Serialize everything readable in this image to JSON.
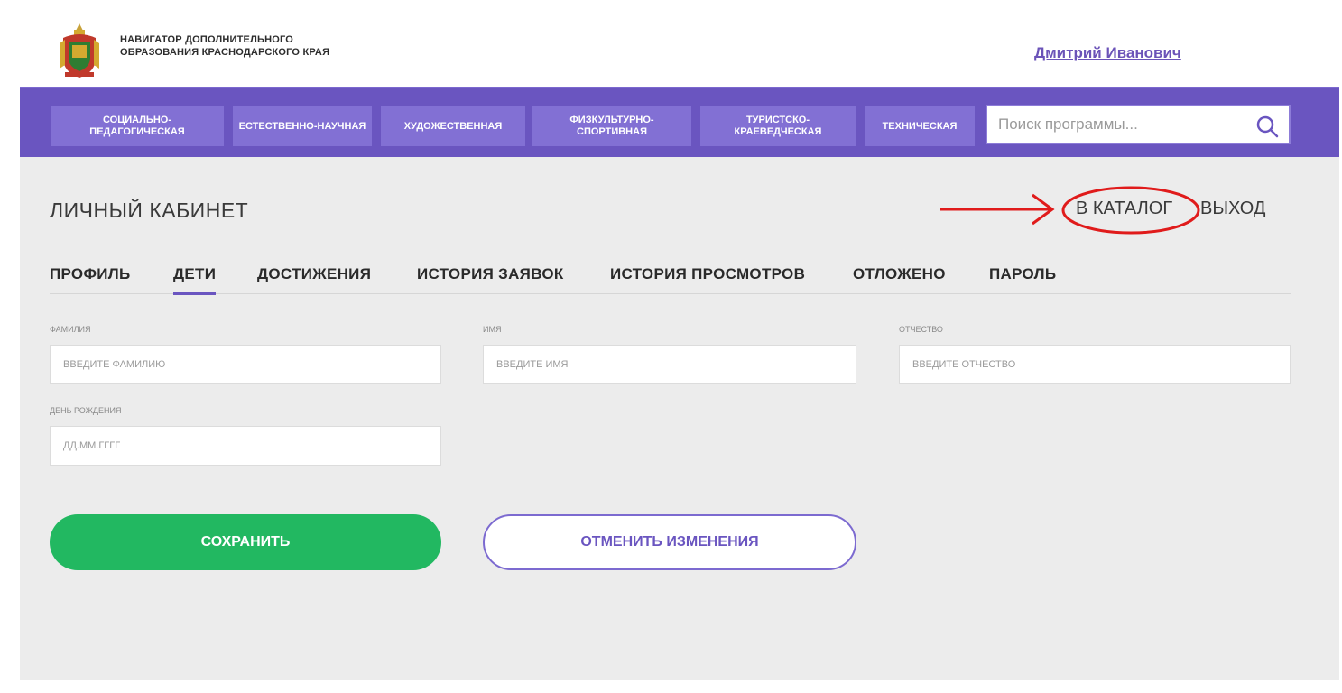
{
  "header": {
    "logo_icon": "krasnodar-coat-of-arms-icon",
    "site_title": "Навигатор дополнительного образования Краснодарского края",
    "user_name": "Дмитрий Иванович"
  },
  "nav": {
    "items": [
      {
        "label": "Социально-педагогическая"
      },
      {
        "label": "Естественно-научная"
      },
      {
        "label": "Художественная"
      },
      {
        "label": "Физкультурно-спортивная"
      },
      {
        "label": "Туристско-краеведческая"
      },
      {
        "label": "Техническая"
      }
    ],
    "search": {
      "placeholder": "Поиск программы...",
      "icon": "search-icon"
    }
  },
  "page": {
    "title": "ЛИЧНЫЙ КАБИНЕТ",
    "catalog_link": "В КАТАЛОГ",
    "exit_link": "ВЫХОД"
  },
  "tabs": [
    {
      "label": "Профиль"
    },
    {
      "label": "Дети",
      "active": true
    },
    {
      "label": "Достижения"
    },
    {
      "label": "История заявок"
    },
    {
      "label": "История просмотров"
    },
    {
      "label": "Отложено"
    },
    {
      "label": "Пароль"
    }
  ],
  "form": {
    "last_name": {
      "label": "Фамилия",
      "placeholder": "Введите фамилию"
    },
    "first_name": {
      "label": "Имя",
      "placeholder": "Введите имя"
    },
    "middle_name": {
      "label": "Отчество",
      "placeholder": "Введите отчество"
    },
    "birthday": {
      "label": "День рождения",
      "placeholder": "ДД.ММ.ГГГГ"
    }
  },
  "buttons": {
    "save": "Сохранить",
    "cancel": "Отменить изменения"
  },
  "colors": {
    "brand_purple": "#6a55c0",
    "nav_button": "#8270d4",
    "save_green": "#22b861",
    "annotation_red": "#e01b1b"
  }
}
